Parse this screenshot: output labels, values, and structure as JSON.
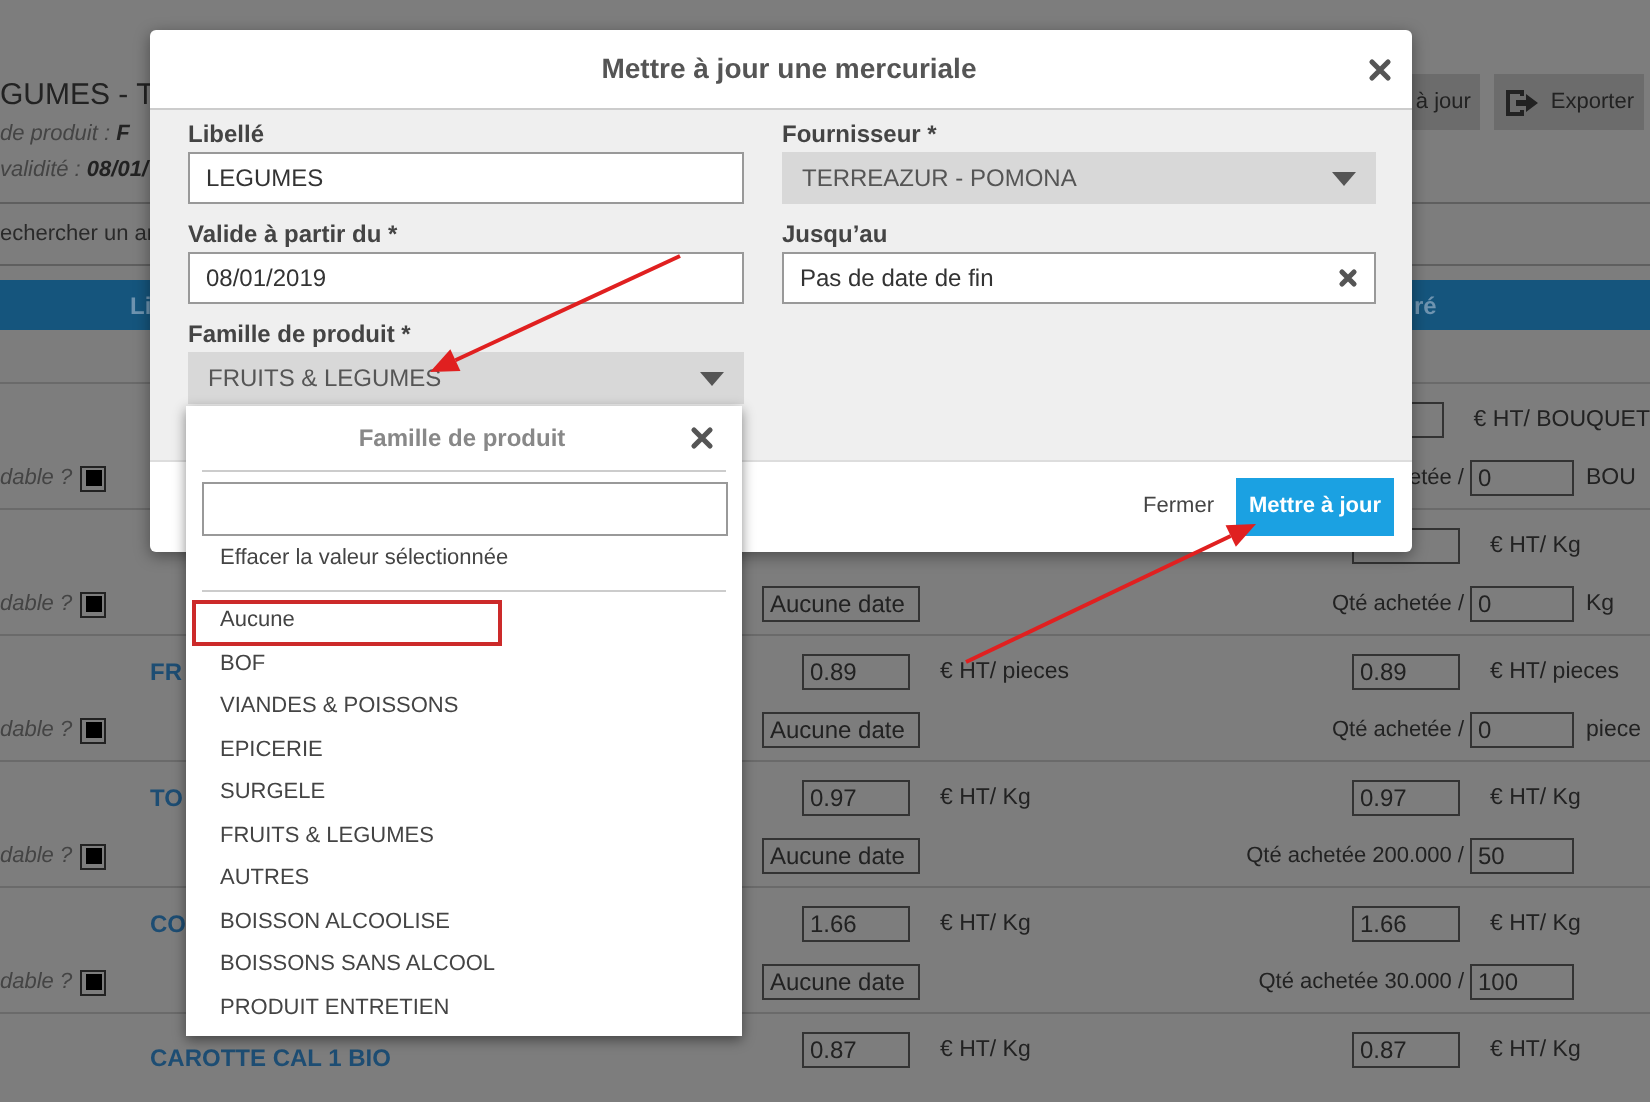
{
  "page": {
    "title": "GUMES - T",
    "family_label": "de produit :",
    "family_value": "F",
    "validity_label": "validité :",
    "validity_value": "08/01/",
    "search_placeholder": "echercher un ar",
    "toolbar": [
      {
        "label": "à jour",
        "kind": "plain"
      },
      {
        "label": "Exporter",
        "kind": "export"
      }
    ],
    "columns": [
      "Li",
      "ré"
    ],
    "rows": [
      {
        "orderable": "dable ?",
        "checked": true,
        "unit2": "€ HT/ BOUQUET",
        "qty_label": "etée /",
        "qty": "0",
        "qty_unit": "BOU"
      },
      {
        "orderable": "dable ?",
        "checked": true,
        "unit2": "€ HT/ Kg",
        "date": "Aucune date",
        "qty_label": "Qté achetée /",
        "qty": "0",
        "qty_unit": "Kg"
      },
      {
        "name": "FR",
        "price1": "0.89",
        "unit1": "€ HT/ pieces",
        "price2": "0.89",
        "unit2": "€ HT/ pieces",
        "orderable": "dable ?",
        "checked": true,
        "date": "Aucune date",
        "qty_label": "Qté achetée /",
        "qty": "0",
        "qty_unit": "piece"
      },
      {
        "name": "TO",
        "price1": "0.97",
        "unit1": "€ HT/ Kg",
        "price2": "0.97",
        "unit2": "€ HT/ Kg",
        "orderable": "dable ?",
        "checked": true,
        "date": "Aucune date",
        "qty_label": "Qté achetée 200.000 /",
        "qty": "50"
      },
      {
        "name": "CO",
        "price1": "1.66",
        "unit1": "€ HT/ Kg",
        "price2": "1.66",
        "unit2": "€ HT/ Kg",
        "orderable": "dable ?",
        "checked": true,
        "date": "Aucune date",
        "qty_label": "Qté achetée 30.000 /",
        "qty": "100"
      },
      {
        "name": "CAROTTE CAL 1 BIO",
        "price1": "0.87",
        "unit1": "€ HT/ Kg",
        "price2": "0.87",
        "unit2": "€ HT/ Kg"
      }
    ]
  },
  "dialog": {
    "title": "Mettre à jour une mercuriale",
    "fields": [
      {
        "label": "Libellé",
        "kind": "text",
        "value": "LEGUMES"
      },
      {
        "label": "Fournisseur *",
        "kind": "select",
        "value": "TERREAZUR - POMONA"
      },
      {
        "label": "Valide à partir du *",
        "kind": "text",
        "value": "08/01/2019"
      },
      {
        "label": "Jusqu’au",
        "kind": "clearable",
        "value": "Pas de date de fin"
      },
      {
        "label": "Famille de produit *",
        "kind": "select",
        "value": "FRUITS & LEGUMES"
      }
    ],
    "dropdown": {
      "title": "Famille de produit",
      "clear": "Effacer la valeur sélectionnée",
      "options": [
        "Aucune",
        "BOF",
        "VIANDES & POISSONS",
        "EPICERIE",
        "SURGELE",
        "FRUITS & LEGUMES",
        "AUTRES",
        "BOISSON ALCOOLISE",
        "BOISSONS SANS ALCOOL",
        "PRODUIT ENTRETIEN"
      ]
    },
    "buttons": [
      {
        "label": "Fermer",
        "kind": "link"
      },
      {
        "label": "Mettre à jour",
        "kind": "primary"
      }
    ]
  },
  "annotations": [
    {
      "kind": "arrow"
    },
    {
      "kind": "arrow"
    },
    {
      "kind": "highlight"
    }
  ]
}
